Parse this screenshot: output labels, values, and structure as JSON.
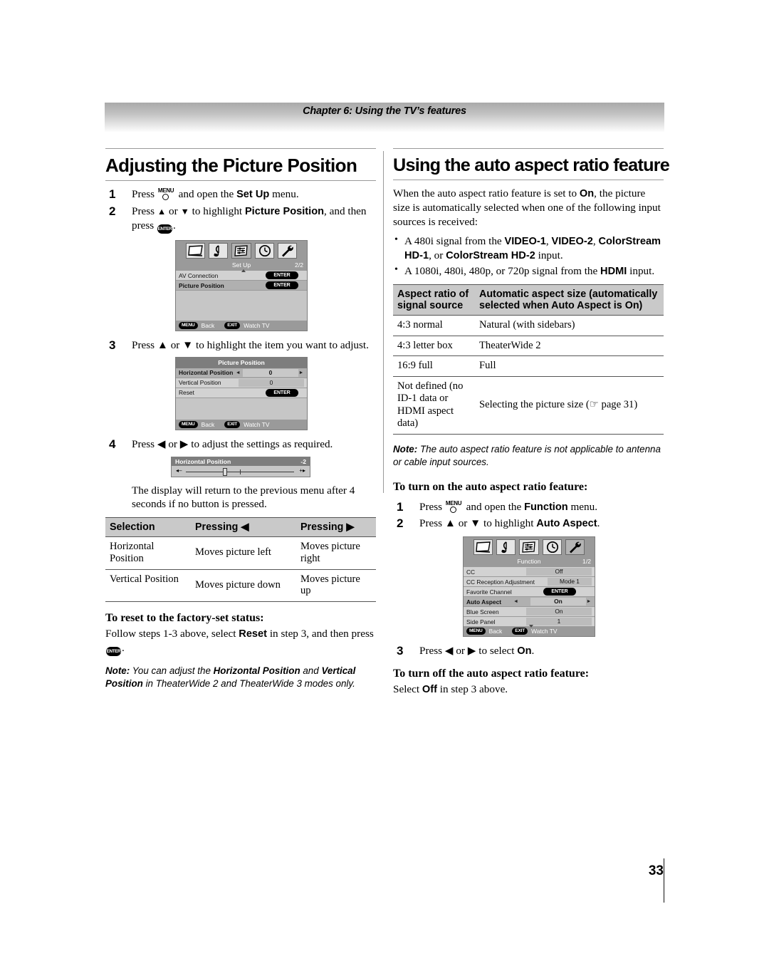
{
  "header": {
    "chapter": "Chapter 6: Using the TV’s features"
  },
  "left_column": {
    "title": "Adjusting the Picture Position",
    "steps": [
      {
        "num": "1",
        "parts": [
          "Press ",
          "MENU_KEY",
          " and open the ",
          "Set Up",
          " menu."
        ]
      },
      {
        "num": "2",
        "parts": [
          "Press ",
          "▲",
          " or ",
          "▼",
          " to highlight ",
          "Picture Position",
          ", and then press ",
          "ENTER_KEY",
          "."
        ]
      },
      {
        "num": "3",
        "parts": [
          "Press ",
          "▲",
          " or ",
          "▼",
          " to highlight the item you want to adjust."
        ]
      },
      {
        "num": "4",
        "parts": [
          "Press ",
          "◀",
          " or ",
          "▶",
          " to adjust the settings as required."
        ]
      }
    ],
    "step1_text_a": "Press",
    "step1_text_b": "and open the",
    "step1_bold": "Set Up",
    "step1_text_c": "menu.",
    "step2_text_a": "Press",
    "step2_text_b": "or",
    "step2_text_c": "to highlight",
    "step2_bold": "Picture Position",
    "step2_text_d": ", and then press",
    "step2_text_e": ".",
    "step3_text": "Press ▲ or ▼ to highlight the item you want to adjust.",
    "step4_text": "Press ◀ or ▶ to adjust the settings as required.",
    "after_step4": "The display will return to the previous menu after 4 seconds if no button is pressed.",
    "reset_heading": "To reset to the factory-set status:",
    "reset_text_a": "Follow steps 1-3 above, select",
    "reset_bold": "Reset",
    "reset_text_b": "in step 3, and then press",
    "reset_text_c": ".",
    "note_label": "Note:",
    "note_text_a": "You can adjust the",
    "note_bold_a": "Horizontal Position",
    "note_text_b": "and",
    "note_bold_b": "Vertical Position",
    "note_text_c": "in TheaterWide 2 and TheaterWide 3 modes only.",
    "selection_table": {
      "headers": [
        "Selection",
        "Pressing ◀",
        "Pressing ▶"
      ],
      "rows": [
        [
          "Horizontal Position",
          "Moves picture left",
          "Moves picture right"
        ],
        [
          "Vertical Position",
          "Moves picture down",
          "Moves picture up"
        ]
      ]
    }
  },
  "right_column": {
    "title": "Using the auto aspect ratio feature",
    "intro_a": "When the auto aspect ratio feature is set to",
    "intro_bold": "On",
    "intro_b": ", the picture size is automatically selected when one of the following input sources is received:",
    "bullets": [
      {
        "pre": "A 480i signal from the ",
        "b1": "VIDEO-1",
        "mid1": ", ",
        "b2": "VIDEO-2",
        "mid2": ", ",
        "b3": "ColorStream HD-1",
        "mid3": ", or ",
        "b4": "ColorStream HD-2",
        "post": " input."
      },
      {
        "pre": "A 1080i, 480i, 480p, or 720p signal from the ",
        "b1": "HDMI",
        "post": " input."
      }
    ],
    "aspect_table": {
      "header_col1": "Aspect ratio of signal source",
      "header_col2": "Automatic aspect size (automatically selected when Auto Aspect is On)",
      "rows": [
        [
          "4:3 normal",
          "Natural (with sidebars)"
        ],
        [
          "4:3 letter box",
          "TheaterWide 2"
        ],
        [
          "16:9 full",
          "Full"
        ],
        [
          "Not defined (no ID-1 data or HDMI aspect data)",
          "Selecting the picture size (☞ page 31)"
        ]
      ]
    },
    "note_label": "Note:",
    "note_text": "The auto aspect ratio feature is not applicable to antenna or cable input sources.",
    "turn_on_heading": "To turn on the auto aspect ratio feature:",
    "on_step1_a": "Press",
    "on_step1_b": "and open the",
    "on_step1_bold": "Function",
    "on_step1_c": "menu.",
    "on_step2_a": "Press ▲ or ▼ to highlight",
    "on_step2_bold": "Auto Aspect",
    "on_step2_b": ".",
    "on_step3_a": "Press ◀ or ▶ to select",
    "on_step3_bold": "On",
    "on_step3_b": ".",
    "turn_off_heading": "To turn off the auto aspect ratio feature:",
    "turn_off_a": "Select",
    "turn_off_bold": "Off",
    "turn_off_b": "in step 3 above."
  },
  "osd_setup": {
    "title": "Set Up",
    "page": "2/2",
    "rows": [
      {
        "label": "AV Connection",
        "value": "ENTER",
        "highlighted": false
      },
      {
        "label": "Picture Position",
        "value": "ENTER",
        "highlighted": true
      }
    ],
    "footer": {
      "menu": "MENU",
      "menu_text": "Back",
      "exit": "EXIT",
      "exit_text": "Watch TV"
    }
  },
  "osd_picture_position": {
    "title": "Picture Position",
    "rows": [
      {
        "label": "Horizontal Position",
        "value": "0",
        "highlighted": true,
        "arrows": true
      },
      {
        "label": "Vertical Position",
        "value": "0",
        "highlighted": false,
        "arrows": false
      },
      {
        "label": "Reset",
        "value": "ENTER",
        "highlighted": false,
        "arrows": false
      }
    ],
    "footer": {
      "menu": "MENU",
      "menu_text": "Back",
      "exit": "EXIT",
      "exit_text": "Watch TV"
    }
  },
  "osd_slider": {
    "title": "Horizontal Position",
    "value": "-2",
    "left_marker": "◂–",
    "right_marker": "+▸"
  },
  "osd_function": {
    "title": "Function",
    "page": "1/2",
    "rows": [
      {
        "label": "CC",
        "value": "Off",
        "highlighted": false,
        "arrows": false
      },
      {
        "label": "CC Reception Adjustment",
        "value": "Mode 1",
        "highlighted": false,
        "arrows": false
      },
      {
        "label": "Favorite Channel",
        "value": "ENTER",
        "highlighted": false,
        "arrows": false
      },
      {
        "label": "Auto Aspect",
        "value": "On",
        "highlighted": true,
        "arrows": true
      },
      {
        "label": "Blue Screen",
        "value": "On",
        "highlighted": false,
        "arrows": false
      },
      {
        "label": "Side Panel",
        "value": "1",
        "highlighted": false,
        "arrows": false
      }
    ],
    "footer": {
      "menu": "MENU",
      "menu_text": "Back",
      "exit": "EXIT",
      "exit_text": "Watch TV"
    }
  },
  "keys": {
    "menu_label": "MENU",
    "enter_label": "ENTER"
  },
  "footer": {
    "page_number": "33"
  },
  "colors": {
    "osd_background": "#c6c6c6",
    "osd_header": "#9a9a9a",
    "osd_highlight": "#b0b0b0",
    "table_header": "#c9c9c9",
    "rule": "#555555"
  }
}
